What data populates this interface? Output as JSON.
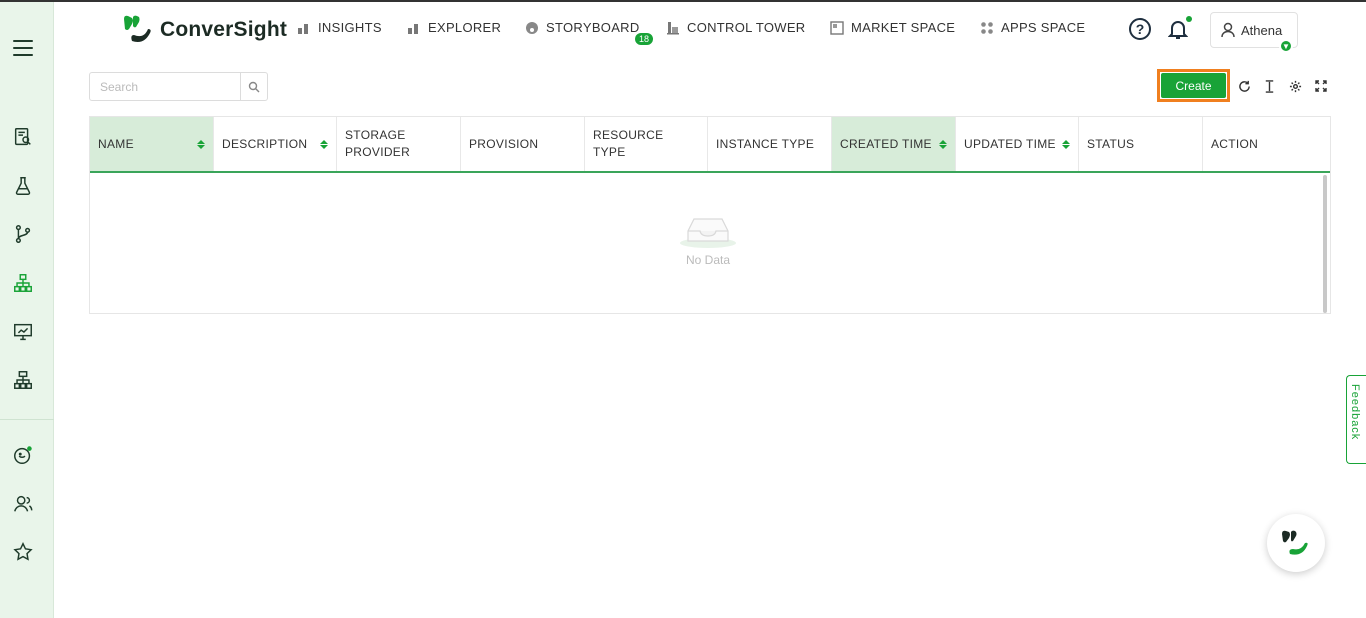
{
  "brand": {
    "name": "ConverSight",
    "accent": "#18a337",
    "highlight": "#f07f1f"
  },
  "sidebar": {
    "icons": [
      "menu-icon",
      "report-search-icon",
      "flask-icon",
      "git-branch-icon",
      "hierarchy-icon",
      "presentation-chart-icon",
      "sitemap-icon",
      "bot-face-icon",
      "users-icon",
      "star-icon"
    ]
  },
  "nav": {
    "items": [
      {
        "label": "INSIGHTS",
        "icon": "bar-chart-icon"
      },
      {
        "label": "EXPLORER",
        "icon": "bar-chart-icon"
      },
      {
        "label": "STORYBOARD",
        "icon": "palette-icon",
        "badge": "18"
      },
      {
        "label": "CONTROL TOWER",
        "icon": "tower-icon"
      },
      {
        "label": "MARKET SPACE",
        "icon": "market-icon"
      },
      {
        "label": "APPS SPACE",
        "icon": "apps-icon"
      }
    ]
  },
  "user": {
    "name": "Athena"
  },
  "toolbar": {
    "search_placeholder": "Search",
    "create_label": "Create"
  },
  "table": {
    "columns": [
      {
        "label": "NAME",
        "sortable": true,
        "sorted": true
      },
      {
        "label": "DESCRIPTION",
        "sortable": true,
        "sorted": false
      },
      {
        "label": "STORAGE PROVIDER",
        "sortable": false,
        "sorted": false
      },
      {
        "label": "PROVISION",
        "sortable": false,
        "sorted": false
      },
      {
        "label": "RESOURCE TYPE",
        "sortable": false,
        "sorted": false
      },
      {
        "label": "INSTANCE TYPE",
        "sortable": false,
        "sorted": false
      },
      {
        "label": "CREATED TIME",
        "sortable": true,
        "sorted": true
      },
      {
        "label": "UPDATED TIME",
        "sortable": true,
        "sorted": false
      },
      {
        "label": "STATUS",
        "sortable": false,
        "sorted": false
      },
      {
        "label": "ACTION",
        "sortable": false,
        "sorted": false
      }
    ],
    "rows": [],
    "empty_text": "No Data"
  },
  "feedback": {
    "label": "Feedback"
  }
}
